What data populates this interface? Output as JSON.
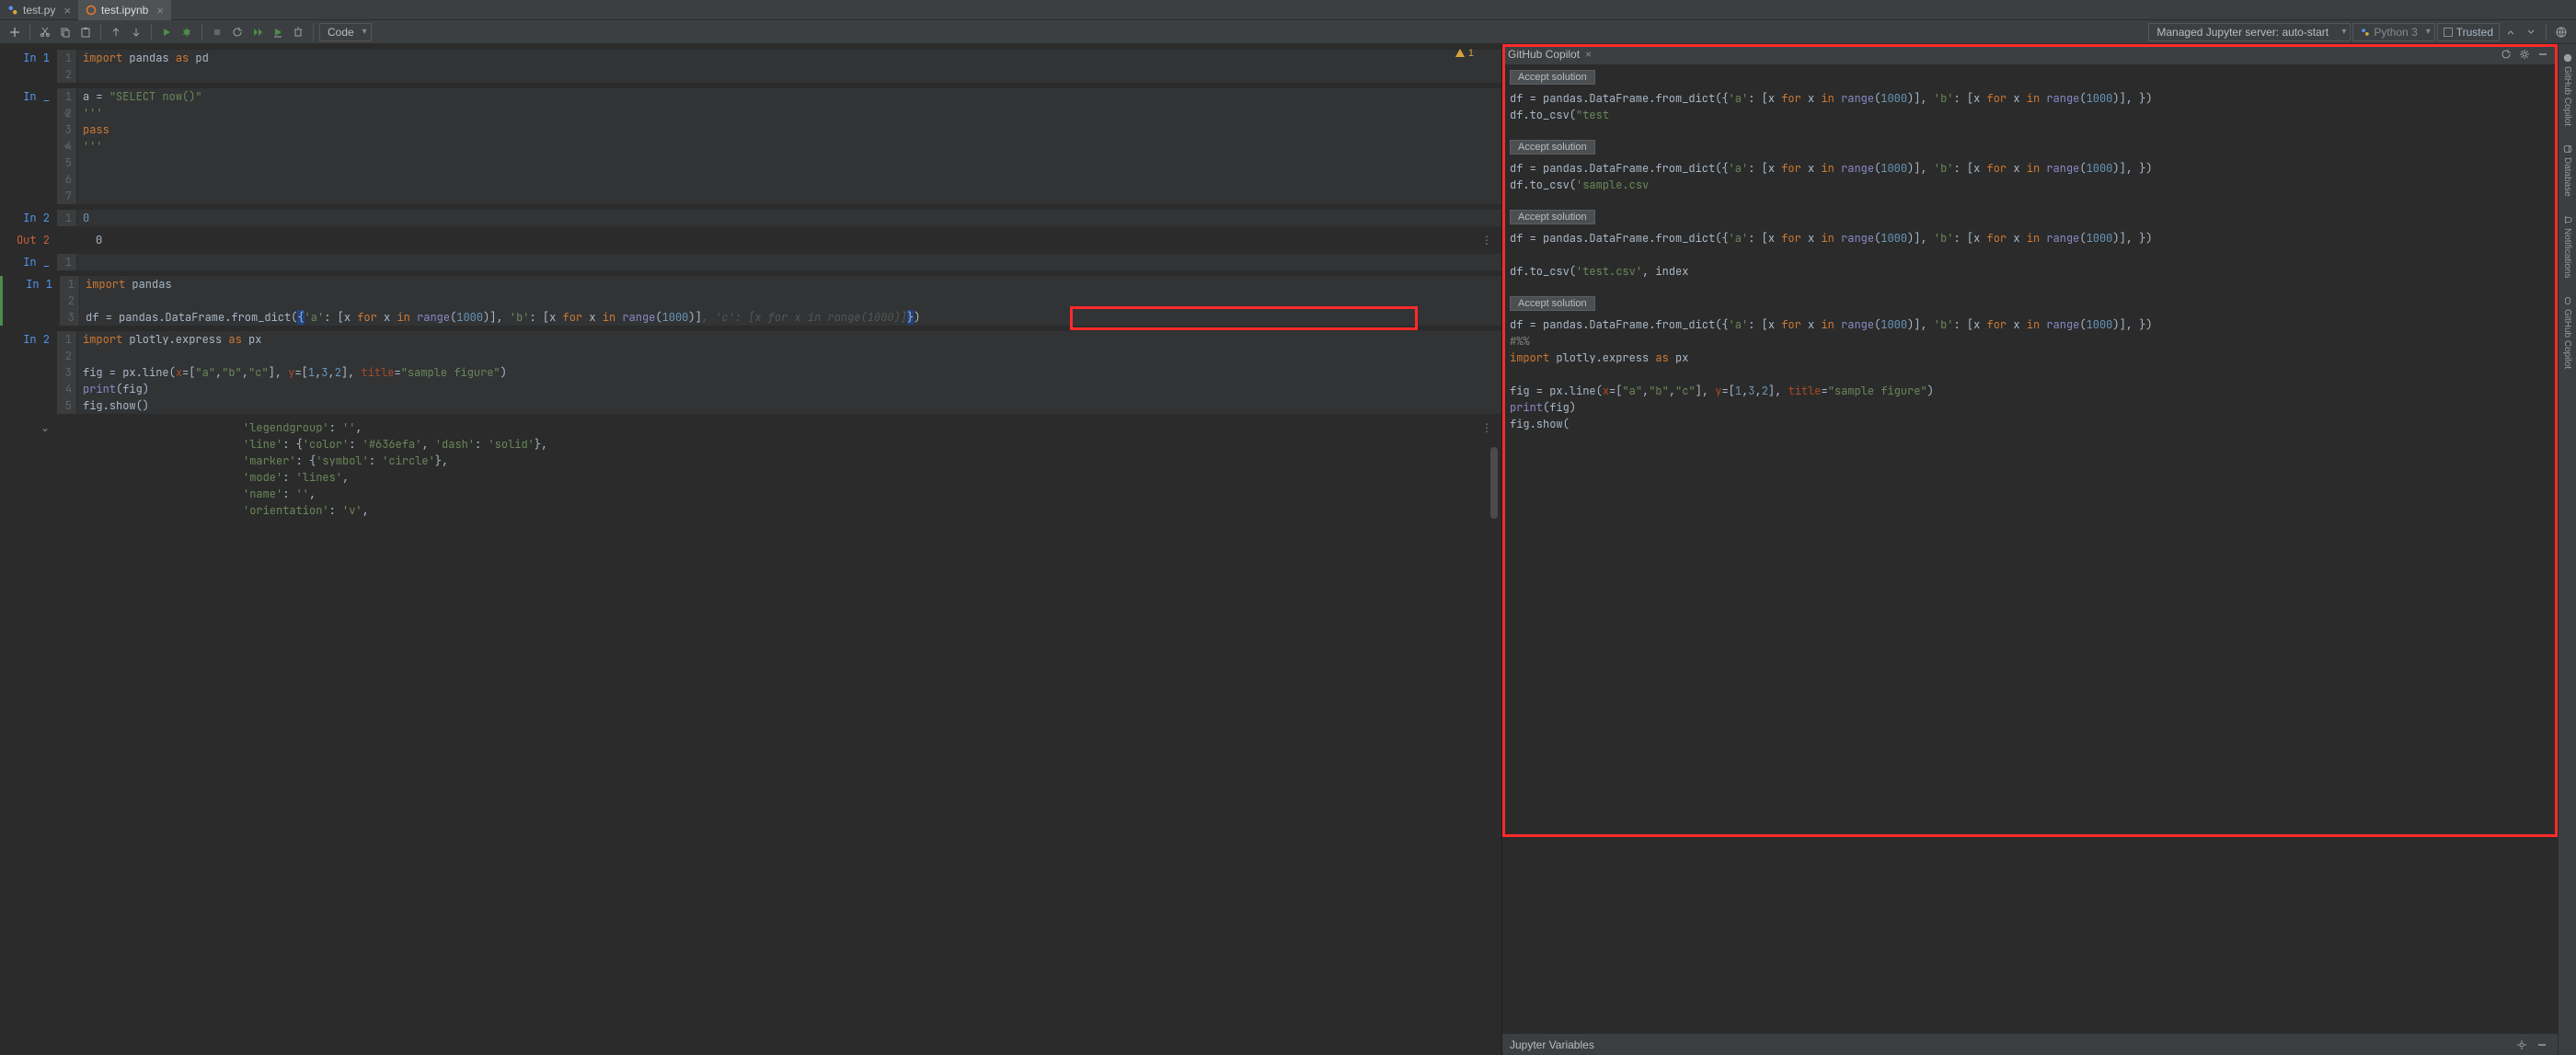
{
  "tabs": [
    {
      "name": "test.py",
      "type": "py",
      "active": false
    },
    {
      "name": "test.ipynb",
      "type": "ipynb",
      "active": true
    }
  ],
  "toolbar": {
    "code_dropdown": "Code",
    "server_label": "Managed Jupyter server: auto-start",
    "kernel_label": "Python 3",
    "trusted_label": "Trusted"
  },
  "warning": {
    "count": "1"
  },
  "cells": [
    {
      "prompt": "In 1",
      "lines": [
        "import pandas as pd",
        ""
      ],
      "active": false
    },
    {
      "prompt": "In _",
      "lines": [
        "a = \"SELECT now()\"",
        "'''",
        "pass",
        "'''",
        "",
        "",
        ""
      ],
      "active": false,
      "fold": [
        2,
        4
      ]
    },
    {
      "prompt": "In 2",
      "lines": [
        "0"
      ],
      "active": false
    },
    {
      "prompt_out": "Out 2",
      "output": "0",
      "is_output": true
    },
    {
      "prompt": "In _",
      "lines": [
        ""
      ],
      "active": false
    },
    {
      "prompt": "In 1",
      "lines": [
        "import pandas",
        "",
        "df = pandas.DataFrame.from_dict({'a': [x for x in range(1000)], 'b': [x for x in range(1000)], 'c': [x for x in range(1000)]})"
      ],
      "ghost_on_line": 3,
      "ghost_start_col": 0,
      "active": true
    },
    {
      "prompt": "In 2",
      "lines": [
        "import plotly.express as px",
        "",
        "fig = px.line(x=[\"a\",\"b\",\"c\"], y=[1,3,2], title=\"sample figure\")",
        "print(fig)",
        "fig.show()"
      ],
      "active": false
    },
    {
      "is_json_output": true,
      "prompt_out": "",
      "output_lines": [
        "'legendgroup': '',",
        "'line': {'color': '#636efa', 'dash': 'solid'},",
        "'marker': {'symbol': 'circle'},",
        "'mode': 'lines',",
        "'name': '',",
        "'orientation': 'v',"
      ]
    }
  ],
  "copilot": {
    "title": "GitHub Copilot",
    "accept_label": "Accept solution",
    "solutions": [
      "df = pandas.DataFrame.from_dict({'a': [x for x in range(1000)], 'b': [x for x in range(1000)], })\ndf.to_csv(\"test",
      "df = pandas.DataFrame.from_dict({'a': [x for x in range(1000)], 'b': [x for x in range(1000)], })\ndf.to_csv('sample.csv",
      "df = pandas.DataFrame.from_dict({'a': [x for x in range(1000)], 'b': [x for x in range(1000)], })\n\ndf.to_csv('test.csv', index",
      "df = pandas.DataFrame.from_dict({'a': [x for x in range(1000)], 'b': [x for x in range(1000)], })\n#%%\nimport plotly.express as px\n\nfig = px.line(x=[\"a\",\"b\",\"c\"], y=[1,3,2], title=\"sample figure\")\nprint(fig)\nfig.show("
    ]
  },
  "jupyter_vars": {
    "title": "Jupyter Variables"
  },
  "side_tabs": [
    "GitHub Copilot",
    "Database",
    "Notifications",
    "GitHub Copilot"
  ]
}
